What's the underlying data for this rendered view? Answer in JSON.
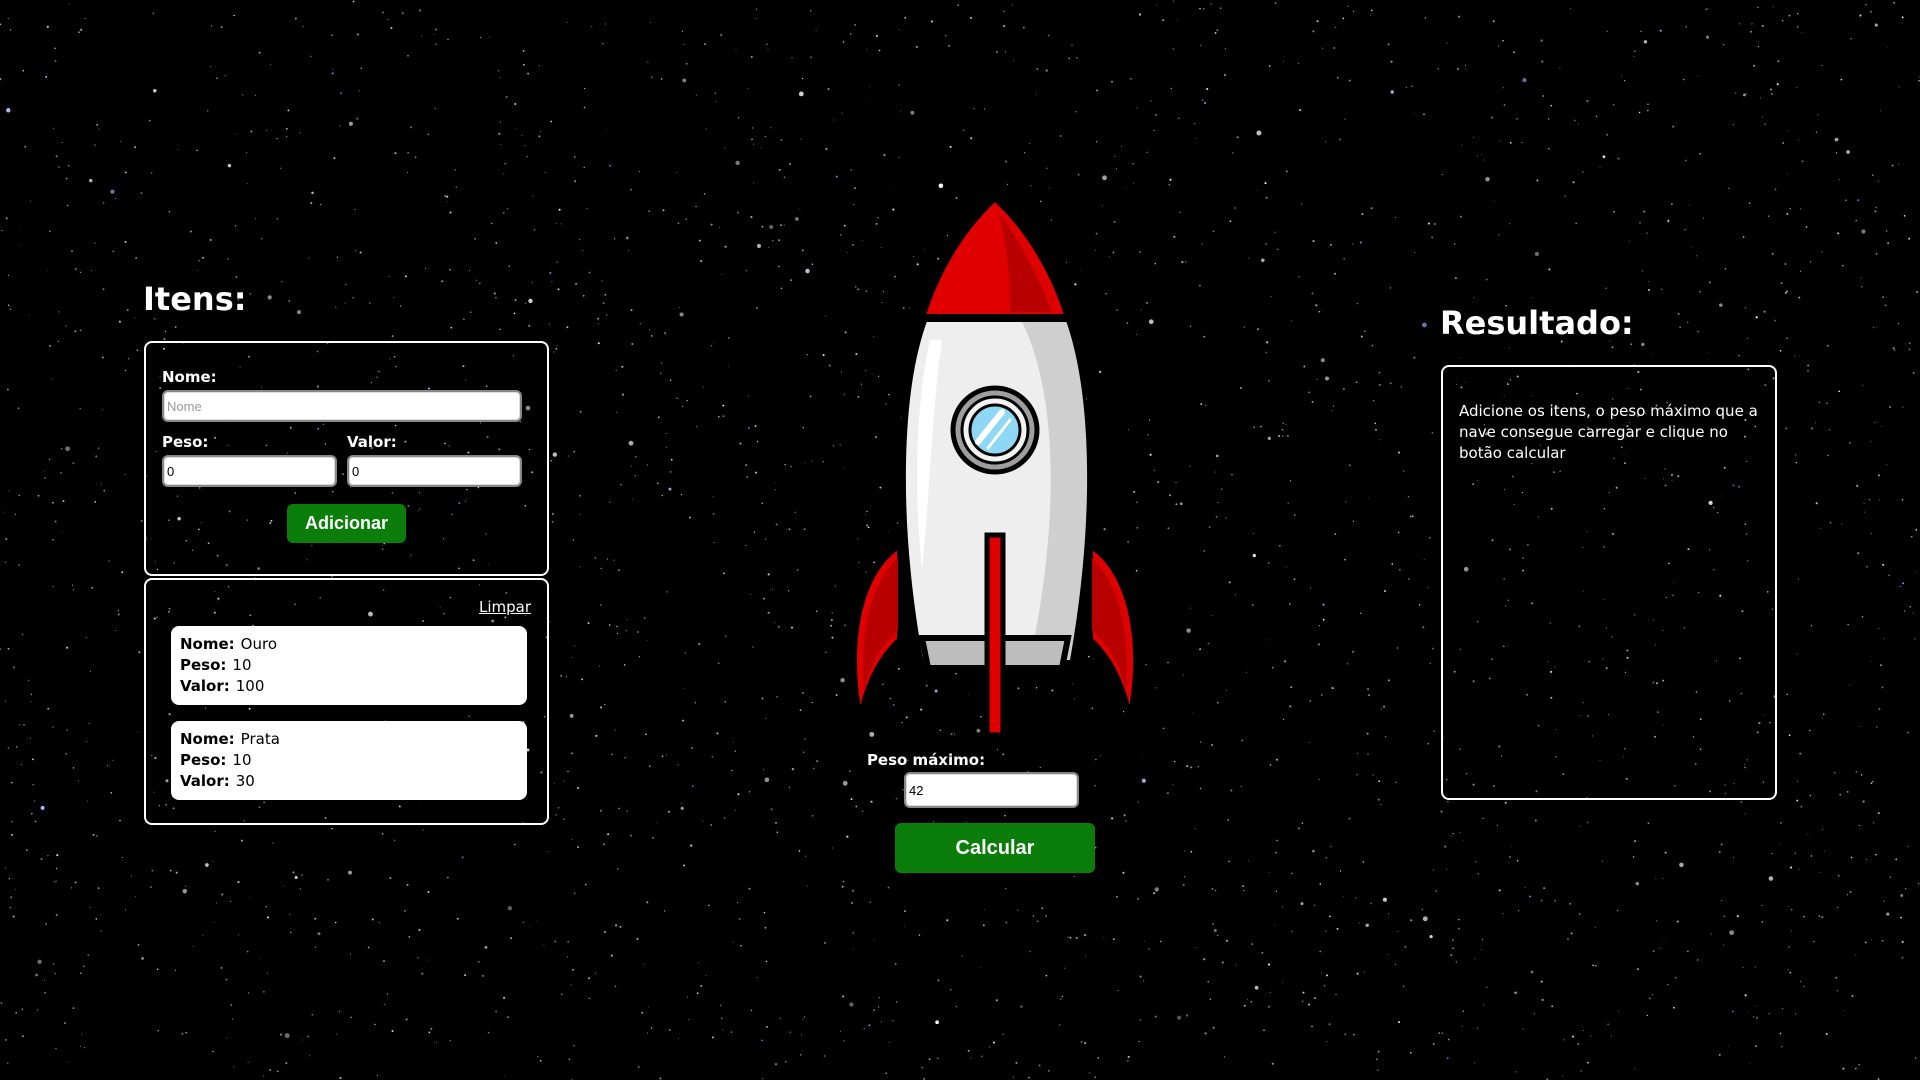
{
  "items_section": {
    "title": "Itens:",
    "form": {
      "name_label": "Nome:",
      "name_placeholder": "Nome",
      "name_value": "",
      "weight_label": "Peso:",
      "weight_value": "0",
      "value_label": "Valor:",
      "value_value": "0",
      "add_button_label": "Adicionar"
    },
    "clear_link_label": "Limpar",
    "items": [
      {
        "name_key": "Nome:",
        "name": "Ouro",
        "weight_key": "Peso:",
        "weight": "10",
        "value_key": "Valor:",
        "value": "100"
      },
      {
        "name_key": "Nome:",
        "name": "Prata",
        "weight_key": "Peso:",
        "weight": "10",
        "value_key": "Valor:",
        "value": "30"
      }
    ]
  },
  "center": {
    "max_weight_label": "Peso máximo:",
    "max_weight_value": "42",
    "calc_button_label": "Calcular"
  },
  "result_section": {
    "title": "Resultado:",
    "text": "Adicione os itens, o peso máximo que a nave consegue carregar e clique no botão calcular"
  },
  "colors": {
    "background": "#000000",
    "button_green": "#0a7d0a",
    "rocket_red": "#e00000",
    "rocket_body": "#eeeeee"
  }
}
